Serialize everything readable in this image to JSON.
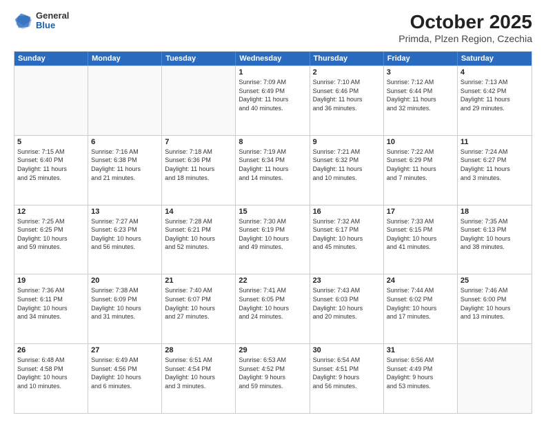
{
  "logo": {
    "general": "General",
    "blue": "Blue"
  },
  "title": "October 2025",
  "subtitle": "Primda, Plzen Region, Czechia",
  "days_of_week": [
    "Sunday",
    "Monday",
    "Tuesday",
    "Wednesday",
    "Thursday",
    "Friday",
    "Saturday"
  ],
  "weeks": [
    [
      {
        "day": "",
        "info": ""
      },
      {
        "day": "",
        "info": ""
      },
      {
        "day": "",
        "info": ""
      },
      {
        "day": "1",
        "info": "Sunrise: 7:09 AM\nSunset: 6:49 PM\nDaylight: 11 hours\nand 40 minutes."
      },
      {
        "day": "2",
        "info": "Sunrise: 7:10 AM\nSunset: 6:46 PM\nDaylight: 11 hours\nand 36 minutes."
      },
      {
        "day": "3",
        "info": "Sunrise: 7:12 AM\nSunset: 6:44 PM\nDaylight: 11 hours\nand 32 minutes."
      },
      {
        "day": "4",
        "info": "Sunrise: 7:13 AM\nSunset: 6:42 PM\nDaylight: 11 hours\nand 29 minutes."
      }
    ],
    [
      {
        "day": "5",
        "info": "Sunrise: 7:15 AM\nSunset: 6:40 PM\nDaylight: 11 hours\nand 25 minutes."
      },
      {
        "day": "6",
        "info": "Sunrise: 7:16 AM\nSunset: 6:38 PM\nDaylight: 11 hours\nand 21 minutes."
      },
      {
        "day": "7",
        "info": "Sunrise: 7:18 AM\nSunset: 6:36 PM\nDaylight: 11 hours\nand 18 minutes."
      },
      {
        "day": "8",
        "info": "Sunrise: 7:19 AM\nSunset: 6:34 PM\nDaylight: 11 hours\nand 14 minutes."
      },
      {
        "day": "9",
        "info": "Sunrise: 7:21 AM\nSunset: 6:32 PM\nDaylight: 11 hours\nand 10 minutes."
      },
      {
        "day": "10",
        "info": "Sunrise: 7:22 AM\nSunset: 6:29 PM\nDaylight: 11 hours\nand 7 minutes."
      },
      {
        "day": "11",
        "info": "Sunrise: 7:24 AM\nSunset: 6:27 PM\nDaylight: 11 hours\nand 3 minutes."
      }
    ],
    [
      {
        "day": "12",
        "info": "Sunrise: 7:25 AM\nSunset: 6:25 PM\nDaylight: 10 hours\nand 59 minutes."
      },
      {
        "day": "13",
        "info": "Sunrise: 7:27 AM\nSunset: 6:23 PM\nDaylight: 10 hours\nand 56 minutes."
      },
      {
        "day": "14",
        "info": "Sunrise: 7:28 AM\nSunset: 6:21 PM\nDaylight: 10 hours\nand 52 minutes."
      },
      {
        "day": "15",
        "info": "Sunrise: 7:30 AM\nSunset: 6:19 PM\nDaylight: 10 hours\nand 49 minutes."
      },
      {
        "day": "16",
        "info": "Sunrise: 7:32 AM\nSunset: 6:17 PM\nDaylight: 10 hours\nand 45 minutes."
      },
      {
        "day": "17",
        "info": "Sunrise: 7:33 AM\nSunset: 6:15 PM\nDaylight: 10 hours\nand 41 minutes."
      },
      {
        "day": "18",
        "info": "Sunrise: 7:35 AM\nSunset: 6:13 PM\nDaylight: 10 hours\nand 38 minutes."
      }
    ],
    [
      {
        "day": "19",
        "info": "Sunrise: 7:36 AM\nSunset: 6:11 PM\nDaylight: 10 hours\nand 34 minutes."
      },
      {
        "day": "20",
        "info": "Sunrise: 7:38 AM\nSunset: 6:09 PM\nDaylight: 10 hours\nand 31 minutes."
      },
      {
        "day": "21",
        "info": "Sunrise: 7:40 AM\nSunset: 6:07 PM\nDaylight: 10 hours\nand 27 minutes."
      },
      {
        "day": "22",
        "info": "Sunrise: 7:41 AM\nSunset: 6:05 PM\nDaylight: 10 hours\nand 24 minutes."
      },
      {
        "day": "23",
        "info": "Sunrise: 7:43 AM\nSunset: 6:03 PM\nDaylight: 10 hours\nand 20 minutes."
      },
      {
        "day": "24",
        "info": "Sunrise: 7:44 AM\nSunset: 6:02 PM\nDaylight: 10 hours\nand 17 minutes."
      },
      {
        "day": "25",
        "info": "Sunrise: 7:46 AM\nSunset: 6:00 PM\nDaylight: 10 hours\nand 13 minutes."
      }
    ],
    [
      {
        "day": "26",
        "info": "Sunrise: 6:48 AM\nSunset: 4:58 PM\nDaylight: 10 hours\nand 10 minutes."
      },
      {
        "day": "27",
        "info": "Sunrise: 6:49 AM\nSunset: 4:56 PM\nDaylight: 10 hours\nand 6 minutes."
      },
      {
        "day": "28",
        "info": "Sunrise: 6:51 AM\nSunset: 4:54 PM\nDaylight: 10 hours\nand 3 minutes."
      },
      {
        "day": "29",
        "info": "Sunrise: 6:53 AM\nSunset: 4:52 PM\nDaylight: 9 hours\nand 59 minutes."
      },
      {
        "day": "30",
        "info": "Sunrise: 6:54 AM\nSunset: 4:51 PM\nDaylight: 9 hours\nand 56 minutes."
      },
      {
        "day": "31",
        "info": "Sunrise: 6:56 AM\nSunset: 4:49 PM\nDaylight: 9 hours\nand 53 minutes."
      },
      {
        "day": "",
        "info": ""
      }
    ]
  ]
}
